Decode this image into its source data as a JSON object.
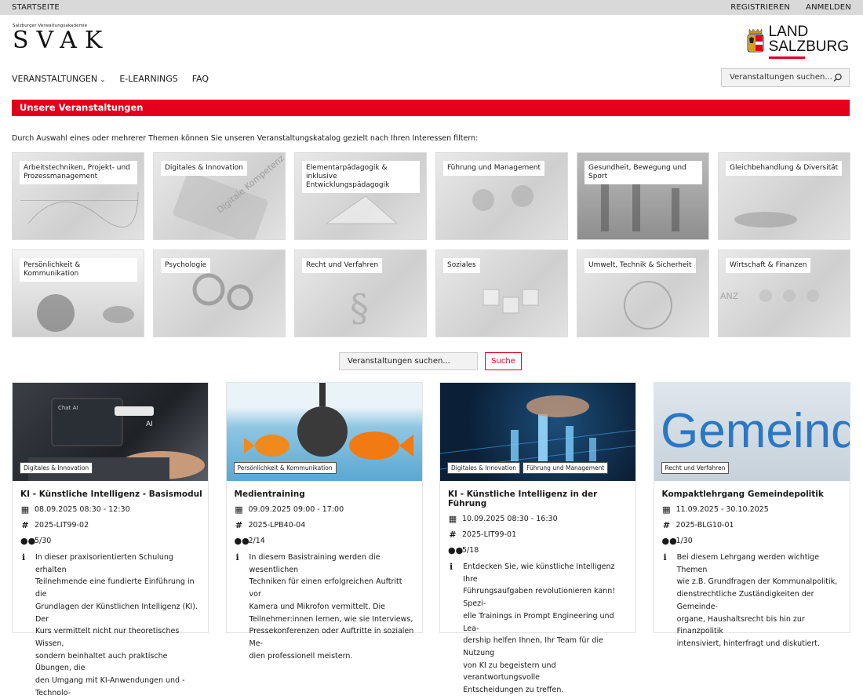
{
  "topbar": {
    "home": "STARTSEITE",
    "register": "REGISTRIEREN",
    "login": "ANMELDEN"
  },
  "logo": {
    "small": "Salzburger Verwaltungsakademie",
    "big": "SVAK"
  },
  "land_logo": {
    "line1": "LAND",
    "line2": "SALZBURG"
  },
  "nav": {
    "items": [
      "VERANSTALTUNGEN",
      "E-LEARNINGS",
      "FAQ"
    ],
    "search_placeholder": "Veranstaltungen suchen..."
  },
  "section_title": "Unsere Veranstaltungen",
  "intro": "Durch Auswahl eines oder mehrerer Themen können Sie unseren Veranstaltungskatalog gezielt nach Ihren Interessen filtern:",
  "topics": [
    "Arbeitstechniken, Projekt- und Prozessmanagement",
    "Digitales & Innovation",
    "Elementarpädagogik & inklusive Entwicklungspädagogik",
    "Führung und Management",
    "Gesundheit, Bewegung und Sport",
    "Gleichbehandlung & Diversität",
    "Persönlichkeit & Kommunikation",
    "Psychologie",
    "Recht und Verfahren",
    "Soziales",
    "Umwelt, Technik & Sicherheit",
    "Wirtschaft & Finanzen"
  ],
  "search": {
    "placeholder": "Veranstaltungen suchen...",
    "button": "Suche"
  },
  "cards": [
    {
      "tags": [
        "Digitales & Innovation"
      ],
      "title": "KI - Künstliche Intelligenz - Basismodul",
      "date": "08.09.2025 08:30 - 12:30",
      "code": "2025-LIT99-02",
      "seats": "5/30",
      "desc": [
        "In dieser praxisorientierten Schulung erhalten",
        "Teilnehmende eine fundierte Einführung in die",
        "Grundlagen der Künstlichen Intelligenz (KI). Der",
        "Kurs vermittelt nicht nur theoretisches Wissen,",
        "sondern beinhaltet auch praktische Übungen, die",
        "den Umgang mit KI-Anwendungen und -Technolo-"
      ]
    },
    {
      "tags": [
        "Persönlichkeit & Kommunikation"
      ],
      "title": "Medientraining",
      "date": "09.09.2025 09:00 - 17:00",
      "code": "2025-LPB40-04",
      "seats": "2/14",
      "desc": [
        "In diesem Basistraining werden die wesentlichen",
        "Techniken für einen erfolgreichen Auftritt vor",
        "Kamera und Mikrofon vermittelt. Die",
        "Teilnehmer:innen lernen, wie sie Interviews,",
        "Pressekonferenzen oder Auftritte in sozialen Me-",
        "dien professionell meistern."
      ]
    },
    {
      "tags": [
        "Digitales & Innovation",
        "Führung und Management"
      ],
      "title": "KI - Künstliche Intelligenz in der Führung",
      "date": "10.09.2025 08:30 - 16:30",
      "code": "2025-LIT99-01",
      "seats": "5/18",
      "desc": [
        "Entdecken Sie, wie künstliche Intelligenz Ihre",
        "Führungsaufgaben revolutionieren kann! Spezi-",
        "elle Trainings in Prompt Engineering und Lea-",
        "dership helfen Ihnen, Ihr Team für die Nutzung",
        "von KI zu begeistern und verantwortungsvolle",
        "Entscheidungen zu treffen."
      ]
    },
    {
      "tags": [
        "Recht und Verfahren"
      ],
      "title": "Kompaktlehrgang Gemeindepolitik",
      "date": "11.09.2025 - 30.10.2025",
      "code": "2025-BLG10-01",
      "seats": "1/30",
      "desc": [
        "Bei diesem Lehrgang werden wichtige Themen",
        "wie z.B. Grundfragen der Kommunalpolitik,",
        "dienstrechtliche Zuständigkeiten der Gemeinde-",
        "organe, Haushaltsrecht bis hin zur Finanzpolitik",
        "intensiviert, hinterfragt und diskutiert."
      ]
    }
  ],
  "card_image_texts": {
    "chat_ai": "Chat AI",
    "ai": "AI",
    "gemeinde": "Gemeind",
    "digitale": "Digitale Kompetenz",
    "anz": "ANZ"
  }
}
